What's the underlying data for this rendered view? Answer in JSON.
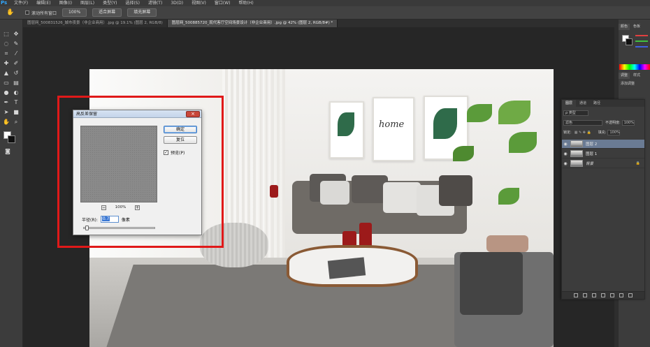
{
  "app": {
    "logo": "Ps",
    "menu": [
      "文件(F)",
      "编辑(E)",
      "图像(I)",
      "图层(L)",
      "类型(Y)",
      "选择(S)",
      "滤镜(T)",
      "3D(D)",
      "视图(V)",
      "窗口(W)",
      "帮助(H)"
    ]
  },
  "options_bar": {
    "tool_icon": "hand-icon",
    "scroll_all_label": "滚动所有窗口",
    "btn_100": "100%",
    "btn_fit": "适合屏幕",
    "btn_fill": "填充屏幕"
  },
  "tabs": [
    {
      "label": "图层网_500831526_城市夜景（非企业商用）.jpg @ 19.1% (图层 2, RGB/8)",
      "active": false
    },
    {
      "label": "图层网_500885720_现代客厅空间场景设计（非企业商用）.jpg @ 42% (图层 2, RGB/8#) *",
      "active": true
    }
  ],
  "canvas": {
    "art_text": "home"
  },
  "dialog": {
    "title": "高反差保留",
    "close": "×",
    "ok": "确定",
    "reset": "复位",
    "preview_label": "预览(P)",
    "preview_checked": "✓",
    "zoom_minus": "−",
    "zoom_plus": "+",
    "zoom": "100%",
    "radius_label": "半径(R):",
    "radius_value": "0.7",
    "radius_unit": "像素",
    "slider_fraction": 0.02
  },
  "right_panel": {
    "tabs_top": [
      "颜色",
      "色板"
    ],
    "tabs_mid": [
      "调整",
      "样式"
    ],
    "add_adjustment": "添加调整"
  },
  "layers_panel": {
    "tabs": [
      "图层",
      "通道",
      "路径"
    ],
    "kind_filter": "ρ 类型",
    "blend_mode": "滤色",
    "opacity_label": "不透明度:",
    "opacity_value": "100%",
    "lock_label": "锁定:",
    "fill_label": "填充:",
    "fill_value": "100%",
    "layers": [
      {
        "name": "图层 2",
        "selected": true,
        "locked": false
      },
      {
        "name": "图层 1",
        "selected": false,
        "locked": false
      },
      {
        "name": "背景",
        "selected": false,
        "locked": true
      }
    ]
  },
  "colors": {
    "highlight_box": "#e01919",
    "selected_layer": "#6a7b94"
  }
}
